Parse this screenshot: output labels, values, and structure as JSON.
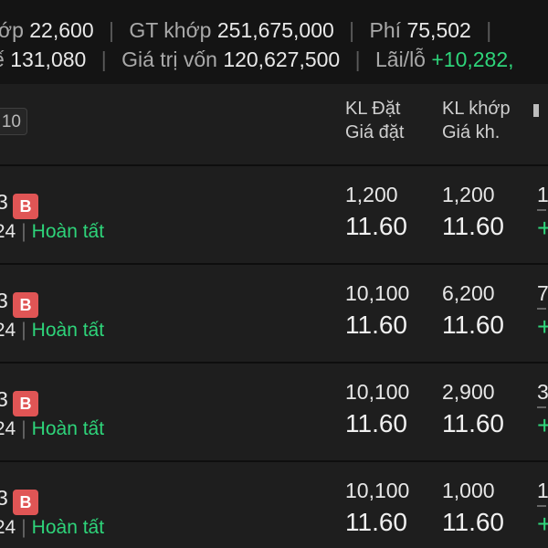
{
  "summary": {
    "line1": [
      {
        "label": "ớp",
        "value": "22,600"
      },
      {
        "label": "GT khớp",
        "value": "251,675,000"
      },
      {
        "label": "Phí",
        "value": "75,502"
      }
    ],
    "line2": [
      {
        "label": "ế",
        "value": "131,080"
      },
      {
        "label": "Giá trị vốn",
        "value": "120,627,500"
      },
      {
        "label": "Lãi/lỗ",
        "value": "+10,282,"
      }
    ]
  },
  "header": {
    "count": "10",
    "col1": {
      "top": "KL Đặt",
      "bottom": "Giá đặt"
    },
    "col2": {
      "top": "KL khớp",
      "bottom": "Giá kh."
    }
  },
  "orders": [
    {
      "symbol": "3",
      "side": "B",
      "date": "/24",
      "status": "Hoàn tất",
      "order_qty": "1,200",
      "matched_qty": "1,200",
      "order_price": "11.60",
      "matched_price": "11.60",
      "edge_value": "1"
    },
    {
      "symbol": "3",
      "side": "B",
      "date": "/24",
      "status": "Hoàn tất",
      "order_qty": "10,100",
      "matched_qty": "6,200",
      "order_price": "11.60",
      "matched_price": "11.60",
      "edge_value": "7"
    },
    {
      "symbol": "3",
      "side": "B",
      "date": "/24",
      "status": "Hoàn tất",
      "order_qty": "10,100",
      "matched_qty": "2,900",
      "order_price": "11.60",
      "matched_price": "11.60",
      "edge_value": "3"
    },
    {
      "symbol": "3",
      "side": "B",
      "date": "/24",
      "status": "Hoàn tất",
      "order_qty": "10,100",
      "matched_qty": "1,000",
      "order_price": "11.60",
      "matched_price": "11.60",
      "edge_value": "1"
    }
  ],
  "edge_sign": "+",
  "colors": {
    "positive": "#2ed47a",
    "buy_badge": "#e05555",
    "background": "#1e1e1e",
    "summary_bg": "#141414"
  }
}
